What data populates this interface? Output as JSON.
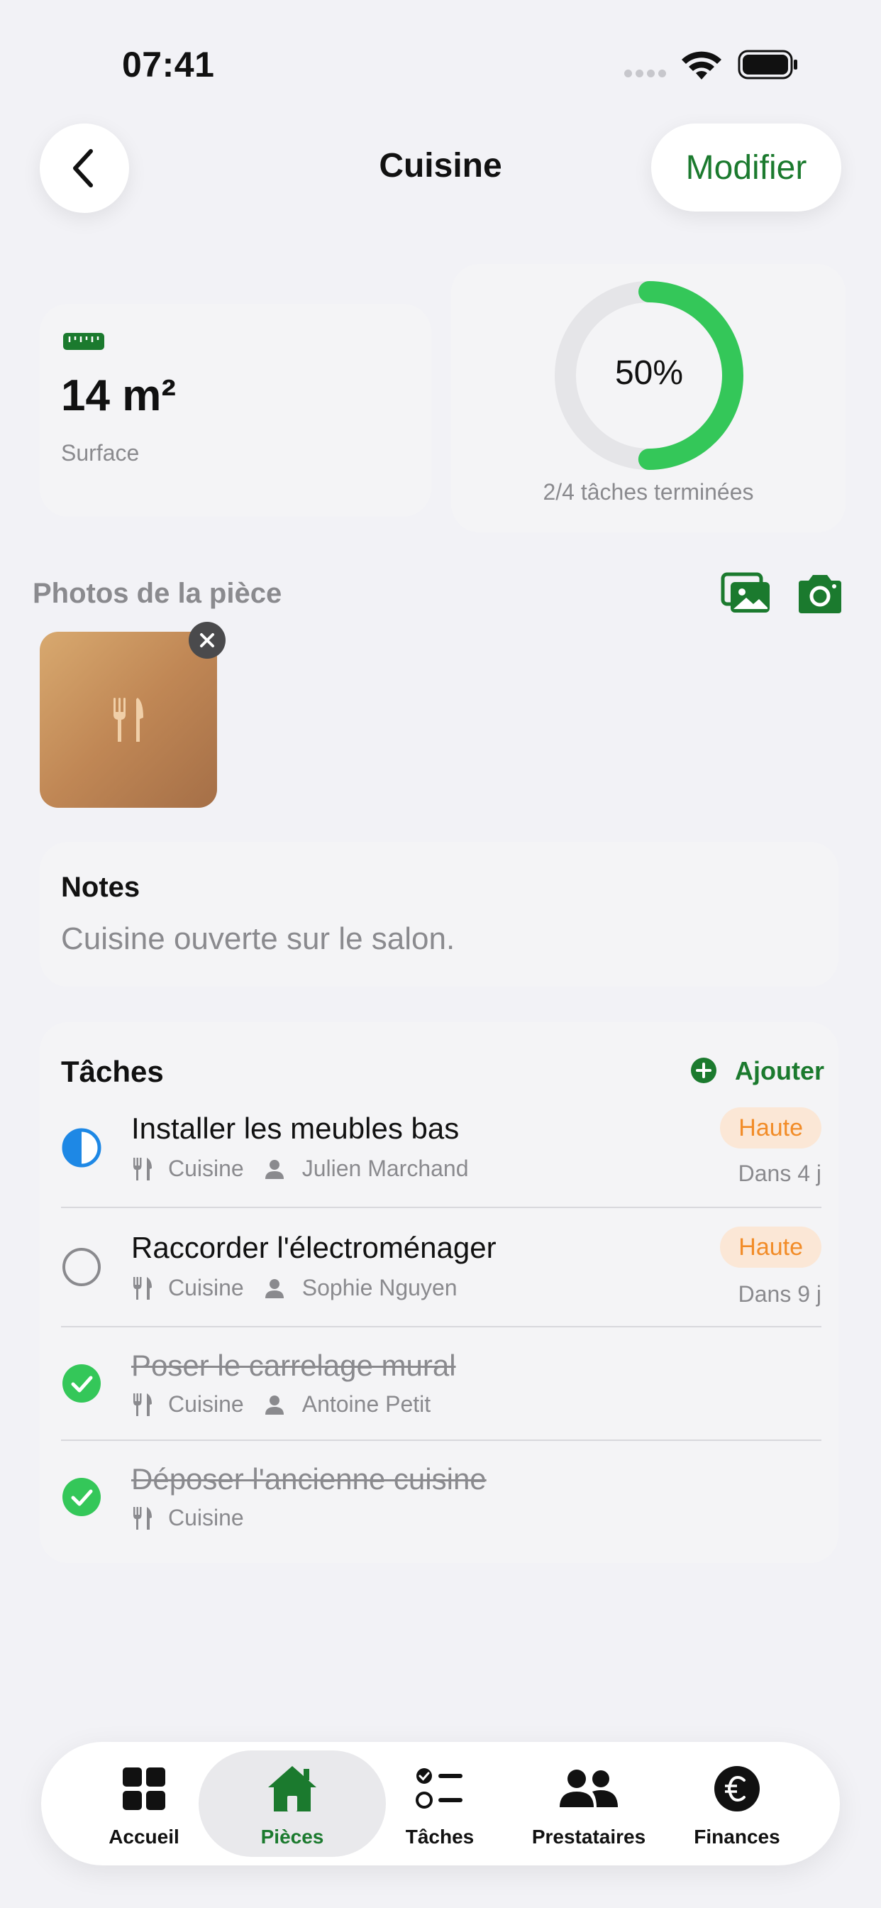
{
  "status_bar": {
    "time": "07:41"
  },
  "nav": {
    "title": "Cuisine",
    "edit_label": "Modifier"
  },
  "surface": {
    "value": "14 m²",
    "label": "Surface"
  },
  "progress": {
    "percent_label": "50%",
    "fraction": 0.5,
    "caption": "2/4 tâches terminées",
    "accent_color": "#34c759"
  },
  "photos": {
    "title": "Photos de la pièce"
  },
  "notes": {
    "title": "Notes",
    "text": "Cuisine ouverte sur le salon."
  },
  "tasks": {
    "title": "Tâches",
    "add_label": "Ajouter",
    "items": [
      {
        "title": "Installer les meubles bas",
        "room": "Cuisine",
        "assignee": "Julien Marchand",
        "priority": "Haute",
        "due": "Dans 4 j",
        "status": "in-progress"
      },
      {
        "title": "Raccorder l'électroménager",
        "room": "Cuisine",
        "assignee": "Sophie Nguyen",
        "priority": "Haute",
        "due": "Dans 9 j",
        "status": "todo"
      },
      {
        "title": "Poser le carrelage mural",
        "room": "Cuisine",
        "assignee": "Antoine Petit",
        "status": "done"
      },
      {
        "title": "Déposer l'ancienne cuisine",
        "room": "Cuisine",
        "status": "done"
      }
    ]
  },
  "tabbar": {
    "items": [
      {
        "label": "Accueil",
        "icon": "grid-icon"
      },
      {
        "label": "Pièces",
        "icon": "house-icon",
        "active": true
      },
      {
        "label": "Tâches",
        "icon": "checklist-icon"
      },
      {
        "label": "Prestataires",
        "icon": "people-icon"
      },
      {
        "label": "Finances",
        "icon": "euro-icon"
      }
    ]
  },
  "colors": {
    "brand_green": "#1b7a2e",
    "done_green": "#34c759",
    "in_progress_blue": "#1e88e5",
    "priority_orange": "#f28c28"
  }
}
